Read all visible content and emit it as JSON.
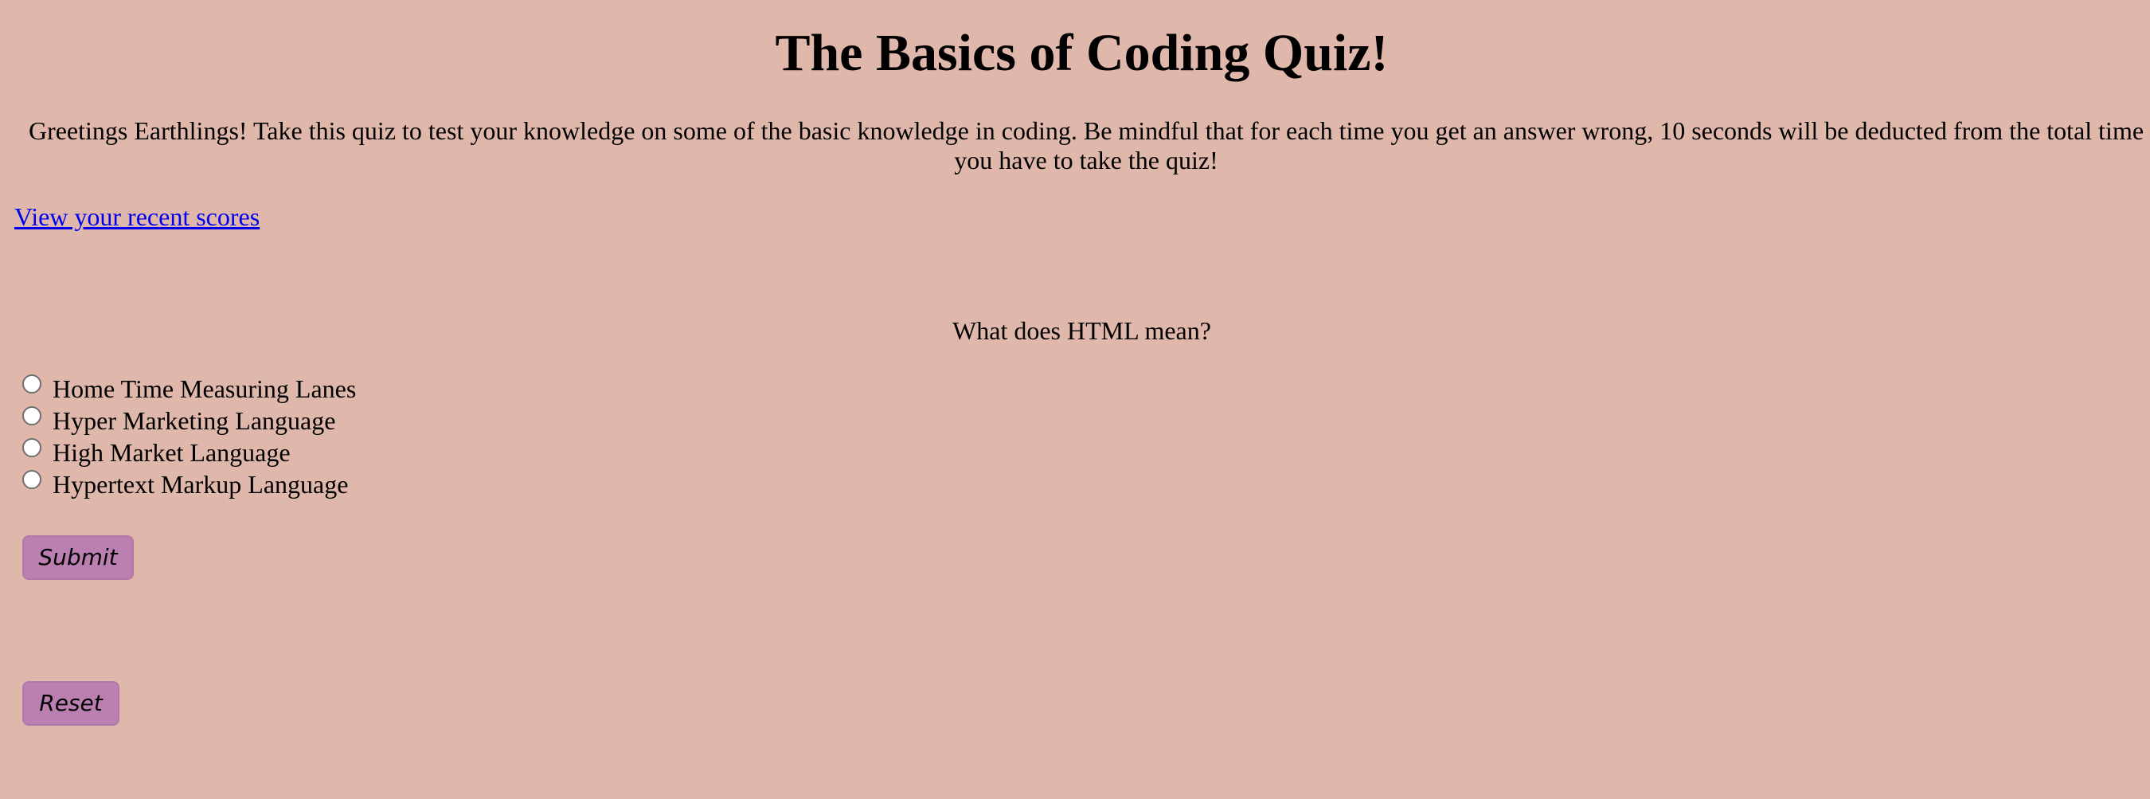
{
  "page": {
    "title": "The Basics of Coding Quiz!",
    "intro": "Greetings Earthlings! Take this quiz to test your knowledge on some of the basic knowledge in coding. Be mindful that for each time you get an answer wrong, 10 seconds will be deducted from the total time you have to take the quiz!",
    "scores_link": "View your recent scores"
  },
  "quiz": {
    "question": "What does HTML mean?",
    "answers": [
      "Home Time Measuring Lanes",
      "Hyper Marketing Language",
      "High Market Language",
      "Hypertext Markup Language"
    ],
    "selected": null,
    "submit_label": "Submit",
    "reset_label": "Reset"
  },
  "colors": {
    "background": "#e0b8ab",
    "button": "#bb7fb2",
    "link": "#0000ee"
  }
}
